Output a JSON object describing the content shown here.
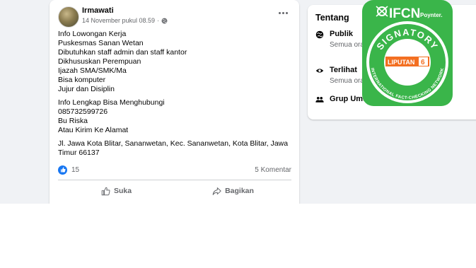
{
  "post": {
    "author": "Irmawati",
    "timestamp": "14 November pukul 08.59",
    "separator": "·",
    "privacy_icon": "globe-icon",
    "more_icon": "more-options-icon",
    "lines": {
      "l1": "Info Lowongan Kerja",
      "l2": "Puskesmas Sanan Wetan",
      "l3": "Dibutuhkan staff admin dan staff kantor",
      "l4": "Dikhususkan Perempuan",
      "l5": "Ijazah SMA/SMK/Ma",
      "l6": "Bisa komputer",
      "l7": "Jujur dan Disiplin",
      "l8": "Info Lengkap Bisa Menghubungi",
      "l9": "085732599726",
      "l10": "Bu Riska",
      "l11": "Atau Kirim Ke Alamat",
      "l12": "Jl. Jawa Kota Blitar, Sananwetan, Kec. Sananwetan, Kota Blitar, Jawa Timur 66137"
    },
    "reaction_count": "15",
    "comments": "5 Komentar",
    "like_label": "Suka",
    "share_label": "Bagikan",
    "accent_color": "#1877f2"
  },
  "about": {
    "title": "Tentang",
    "items": [
      {
        "icon": "globe-icon",
        "title": "Publik",
        "desc": "Semua ora                          ggota grup ini da"
      },
      {
        "icon": "eye-icon",
        "title": "Terlihat",
        "desc": "Semua orang                         p ini."
      },
      {
        "icon": "group-icon",
        "title": "Grup Umum",
        "desc": ""
      }
    ]
  },
  "badge": {
    "ifcn": "IFCN",
    "poynter": "Poynter.",
    "signatory": "SIGNATORY",
    "network": "INTERNATIONAL FACT-CHECKING NETWORK",
    "liputan": "LIPUTAN",
    "liputan_num": "6",
    "brand_green": "#3ab54a",
    "brand_orange": "#f36f21"
  }
}
